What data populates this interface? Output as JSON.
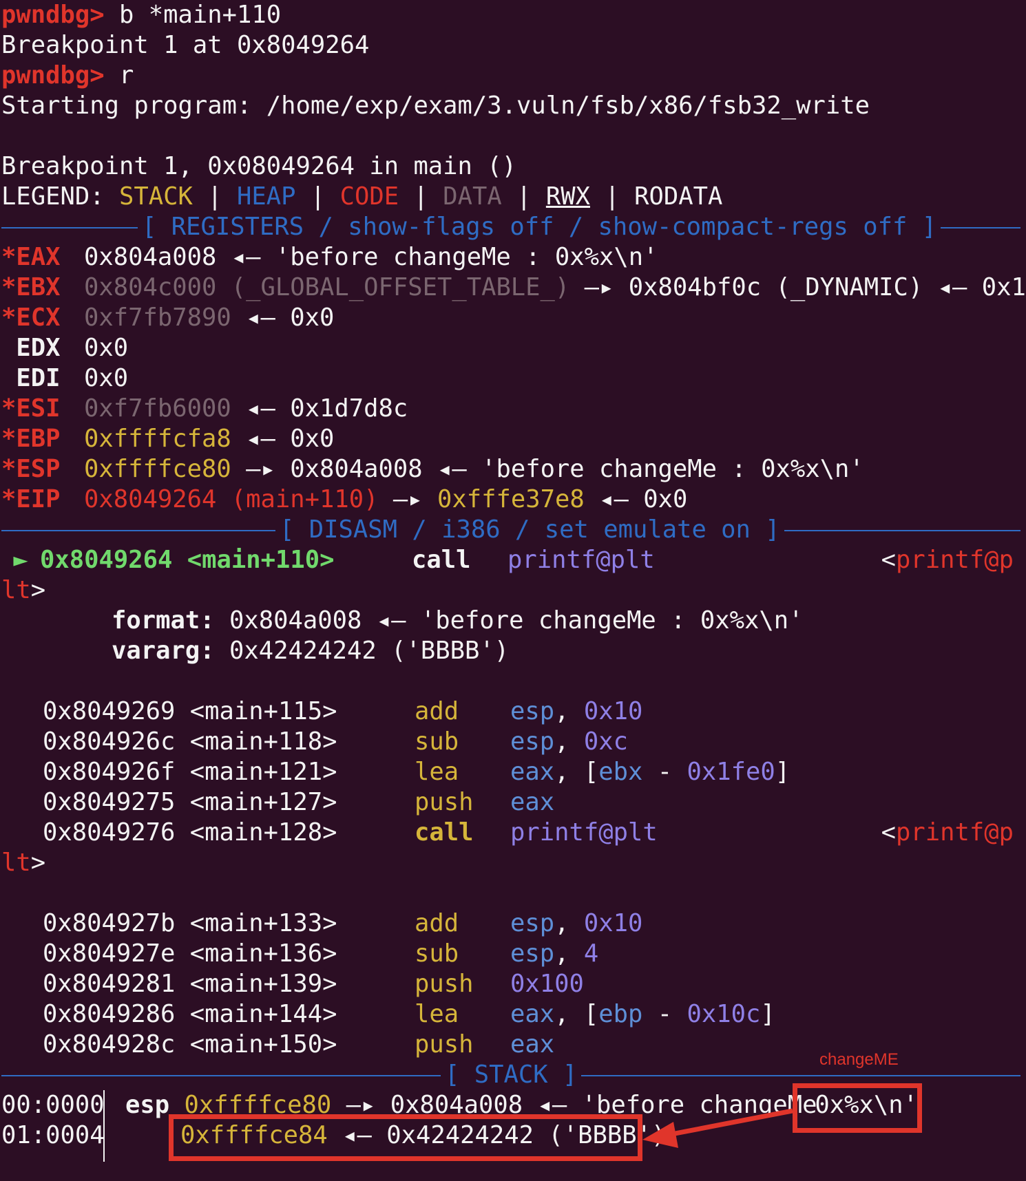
{
  "session": {
    "prompt": "pwndbg>",
    "cmd1": " b *main+110",
    "bp_set": "Breakpoint 1 at 0x8049264",
    "cmd2": " r",
    "starting": "Starting program: /home/exp/exam/3.vuln/fsb/x86/fsb32_write",
    "bp_hit": "Breakpoint 1, 0x08049264 in main ()"
  },
  "legend": {
    "label": "LEGEND: ",
    "stack": "STACK",
    "heap": "HEAP",
    "code": "CODE",
    "data": "DATA",
    "rwx": "RWX",
    "rodata": "RODATA",
    "sep": " | "
  },
  "headers": {
    "registers": "[ REGISTERS / show-flags off / show-compact-regs off ]",
    "disasm": "[ DISASM / i386 / set emulate on ]",
    "stack": "[ STACK ]"
  },
  "registers": {
    "eax": {
      "name": "*EAX",
      "value": "0x804a008",
      "rest": " ◂— 'before changeMe : 0x%x\\n'"
    },
    "ebx": {
      "name": "*EBX",
      "value": "0x804c000 (_GLOBAL_OFFSET_TABLE_)",
      "rest": " —▸ 0x804bf0c (_DYNAMIC) ◂— 0x1"
    },
    "ecx": {
      "name": "*ECX",
      "value": "0xf7fb7890",
      "rest": " ◂— 0x0"
    },
    "edx": {
      "name": " EDX",
      "value": "0x0"
    },
    "edi": {
      "name": " EDI",
      "value": "0x0"
    },
    "esi": {
      "name": "*ESI",
      "value": "0xf7fb6000",
      "rest": " ◂— 0x1d7d8c"
    },
    "ebp": {
      "name": "*EBP",
      "value": "0xffffcfa8",
      "rest": " ◂— 0x0"
    },
    "esp": {
      "name": "*ESP",
      "value": "0xffffce80",
      "rest1": " —▸ 0x804a008 ◂— 'before changeMe : 0x%x\\n'"
    },
    "eip": {
      "name": "*EIP",
      "value": "0x8049264 (main+110)",
      "arrow": " —▸ ",
      "target": "0xfffe37e8",
      "rest": " ◂— 0x0"
    }
  },
  "disasm": {
    "current": {
      "marker": "►",
      "addr": "0x8049264 <main+110>",
      "mnemonic": "call",
      "operand": "printf@plt",
      "target_open": "<",
      "target": "printf@p",
      "wrap_target": "lt",
      "wrap_close": ">"
    },
    "args": {
      "format_label": "format:",
      "format_value": " 0x804a008 ◂— 'before changeMe : 0x%x\\n'",
      "vararg_label": "vararg:",
      "vararg_value": " 0x42424242 ('BBBB')"
    },
    "block1": [
      {
        "addr": "0x8049269 <main+115>",
        "mn": "add",
        "op1": "esp",
        "op2": ", ",
        "op3": "0x10"
      },
      {
        "addr": "0x804926c <main+118>",
        "mn": "sub",
        "op1": "esp",
        "op2": ", ",
        "op3": "0xc"
      },
      {
        "addr": "0x804926f <main+121>",
        "mn": "lea",
        "op1": "eax",
        "op2": ", [",
        "op3": "ebx",
        "op4": " - ",
        "op5": "0x1fe0",
        "op6": "]"
      },
      {
        "addr": "0x8049275 <main+127>",
        "mn": "push",
        "op1": "eax"
      }
    ],
    "call2": {
      "addr": "0x8049276 <main+128>",
      "mnemonic": "call",
      "operand": "printf@plt",
      "target_open": "<",
      "target": "printf@p",
      "wrap_target": "lt",
      "wrap_close": ">"
    },
    "block2": [
      {
        "addr": "0x804927b <main+133>",
        "mn": "add",
        "op1": "esp",
        "op2": ", ",
        "op3": "0x10"
      },
      {
        "addr": "0x804927e <main+136>",
        "mn": "sub",
        "op1": "esp",
        "op2": ", ",
        "op3": "4"
      },
      {
        "addr": "0x8049281 <main+139>",
        "mn": "push",
        "op1": "0x100"
      },
      {
        "addr": "0x8049286 <main+144>",
        "mn": "lea",
        "op1": "eax",
        "op2": ", [",
        "op3": "ebp",
        "op4": " - ",
        "op5": "0x10c",
        "op6": "]"
      },
      {
        "addr": "0x804928c <main+150>",
        "mn": "push",
        "op1": "eax"
      }
    ]
  },
  "stack": {
    "row0": {
      "idx": "00:0000",
      "reg": "esp",
      "addr": "0xffffce80",
      "rest_a": " —▸ 0x804a008 ◂— 'before changeMe",
      "rest_b": " 0x%x\\n'"
    },
    "row1": {
      "idx": "01:0004",
      "addr": "0xffffce84",
      "rest": " ◂— 0x42424242 ('BBBB')"
    }
  },
  "annotation": {
    "label": "changeME",
    "color": "#e0352b"
  },
  "colors": {
    "background": "#2c0e24",
    "prompt_red": "#e0352b",
    "stack_yellow": "#d6b53a",
    "header_blue": "#2f6cc4",
    "operand_purple": "#8f80e6",
    "current_green": "#71d96c"
  }
}
